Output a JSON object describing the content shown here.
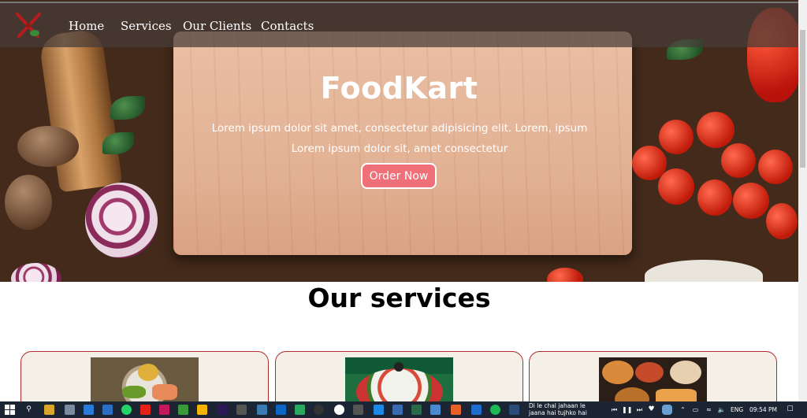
{
  "brand": {
    "logo_icon": "crossed-utensils-icon"
  },
  "nav": {
    "items": [
      {
        "label": "Home"
      },
      {
        "label": "Services"
      },
      {
        "label": "Our Clients"
      },
      {
        "label": "Contacts"
      }
    ]
  },
  "hero": {
    "title": "FoodKart",
    "text_line1": "Lorem ipsum dolor sit amet, consectetur adipisicing elit. Lorem, ipsum",
    "text_line2": "Lorem ipsum dolor sit, amet consectetur",
    "cta_label": "Order Now"
  },
  "services": {
    "title": "Our services",
    "cards": [
      {
        "image": "grilled-salmon-plate-image"
      },
      {
        "image": "salad-bowl-image"
      },
      {
        "image": "table-spread-dishes-image"
      }
    ]
  },
  "taskbar": {
    "media_line1": "Di le chal jahaan le",
    "media_line2": "jaana hai tujhko hai",
    "language": "ENG",
    "time": "09:54 PM"
  },
  "colors": {
    "accent": "#f0707a",
    "card_border": "#b02a2a",
    "card_bg": "#f4efe7",
    "navbar_bg": "rgba(70,60,55,0.72)",
    "taskbar_bg": "#1b2533"
  }
}
